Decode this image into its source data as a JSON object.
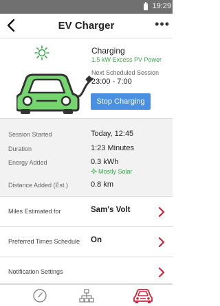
{
  "status_bar": {
    "time": "19:29"
  },
  "nav": {
    "title": "EV Charger",
    "back_icon": "chevron-left-icon",
    "more_label": "•••"
  },
  "charging": {
    "status": "Charging",
    "source": "1.5 kW Excess PV Power",
    "next_label": "Next Scheduled Session",
    "next_time": "23:00 - 7:00",
    "stop_button": "Stop Charging"
  },
  "details": [
    {
      "label": "Session Started",
      "value": "Today, 12:45"
    },
    {
      "label": "Duration",
      "value": "1:23 Minutes"
    },
    {
      "label": "Energy Added",
      "value": "0.3 kWh",
      "note": "Mostly Solar"
    },
    {
      "label": "Distance Added  (Est.)",
      "value": "0.8 km"
    }
  ],
  "settings": [
    {
      "label": "Miles Estimated for",
      "value": "Sam's Volt"
    },
    {
      "label": "Preferred Times Schedule",
      "value": "On"
    },
    {
      "label": "Notification Settings",
      "value": ""
    }
  ],
  "tabs": [
    {
      "icon": "gauge-icon"
    },
    {
      "icon": "network-icon"
    },
    {
      "icon": "car-icon",
      "active": true
    }
  ],
  "colors": {
    "accent_blue": "#4a90e2",
    "green": "#3aa84c",
    "chevron_red": "#d0243a",
    "car_green": "#74d46e"
  }
}
